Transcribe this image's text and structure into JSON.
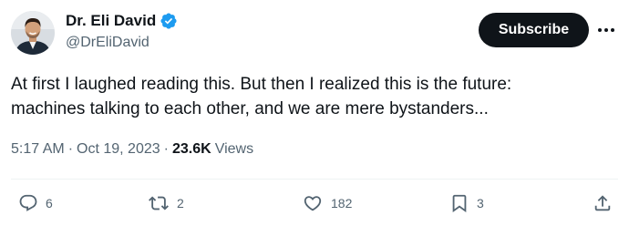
{
  "author": {
    "display_name": "Dr. Eli David",
    "handle": "@DrEliDavid",
    "verified_icon": "verified-badge-icon",
    "verified_color": "#1d9bf0"
  },
  "header": {
    "subscribe_label": "Subscribe",
    "more_icon": "more-horizontal-icon"
  },
  "tweet": {
    "text_lines": [
      "At first I laughed reading this. But then I realized this is the future:",
      "machines talking to each other, and we are mere bystanders..."
    ],
    "time": "5:17 AM",
    "separator": "·",
    "date": "Oct 19, 2023",
    "views_count": "23.6K",
    "views_label": "Views"
  },
  "actions": {
    "reply": {
      "icon": "reply-icon",
      "count": "6"
    },
    "retweet": {
      "icon": "retweet-icon",
      "count": "2"
    },
    "like": {
      "icon": "heart-icon",
      "count": "182"
    },
    "bookmark": {
      "icon": "bookmark-icon",
      "count": "3"
    },
    "share": {
      "icon": "share-icon"
    }
  },
  "colors": {
    "text": "#0f1419",
    "secondary": "#536471",
    "button_bg": "#0f1419",
    "divider": "#eff3f4"
  }
}
